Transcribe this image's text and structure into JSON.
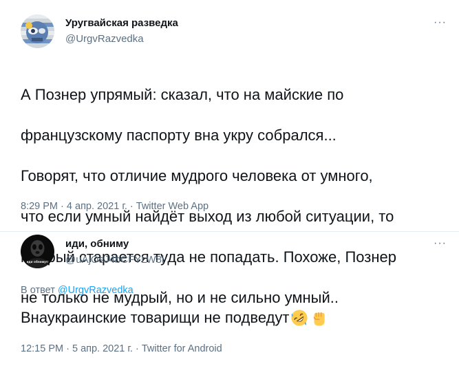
{
  "tweet1": {
    "display_name": "Уругвайская разведка",
    "handle": "@UrgvRazvedka",
    "more": "···",
    "text_lines": [
      "А Познер упрямый: сказал, что на майские по",
      "французскому паспорту вна укру собрался...",
      "Говорят, что отличие мудрого человека от умного,",
      "что если умный найдёт выход из любой ситуации, то",
      "мудрый старается туда не попадать. Похоже, Познер",
      "не только не мудрый, но и не сильно умный.."
    ],
    "time": "8:29 PM",
    "date": "4 апр. 2021 г.",
    "source": "Twitter Web App",
    "separator": "·"
  },
  "tweet2": {
    "display_name": "иди, обниму",
    "handle": "@uAjOsJ4bCFYLW8l",
    "more": "···",
    "avatar_caption": "иди обниму!!",
    "reply_prefix": "В ответ",
    "reply_to": "@UrgvRazvedka",
    "text": "Внаукраинские товарищи не подведут",
    "emojis": [
      "rolling-on-floor-laughing",
      "raised-fist"
    ],
    "time": "12:15 PM",
    "date": "5 апр. 2021 г.",
    "source": "Twitter for Android",
    "separator": "·"
  },
  "colors": {
    "text": "#0f1419",
    "secondary": "#5b7083",
    "link": "#1da1f2",
    "divider": "#e6ecf0",
    "emoji_yellow": "#ffcc4d"
  }
}
